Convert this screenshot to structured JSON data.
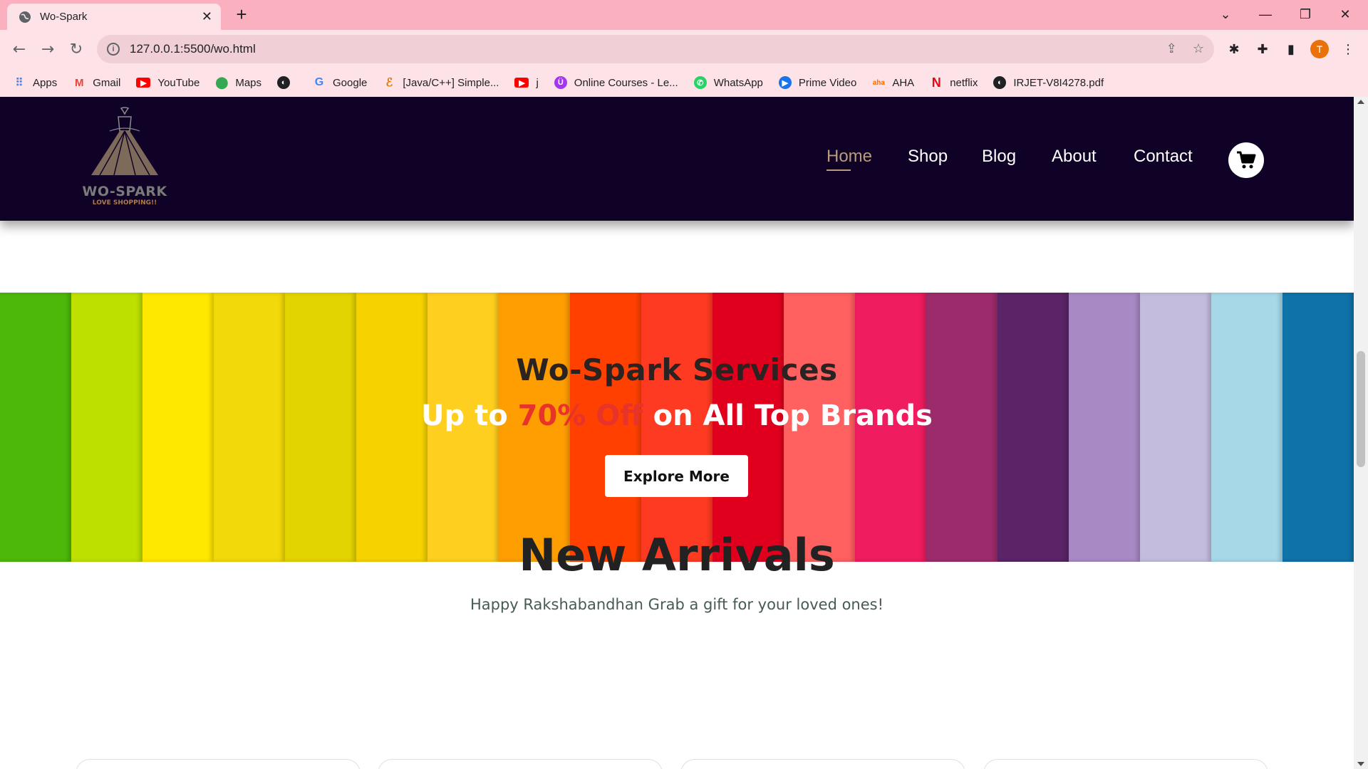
{
  "browser": {
    "tab_title": "Wo-Spark",
    "url": "127.0.0.1:5500/wo.html",
    "profile_initial": "T",
    "bookmarks": [
      {
        "label": "Apps",
        "icon": "apps-grid-icon"
      },
      {
        "label": "Gmail",
        "icon": "gmail-icon"
      },
      {
        "label": "YouTube",
        "icon": "youtube-icon"
      },
      {
        "label": "Maps",
        "icon": "maps-pin-icon"
      },
      {
        "label": "",
        "icon": "globe-icon"
      },
      {
        "label": "Google",
        "icon": "google-icon"
      },
      {
        "label": "[Java/C++] Simple...",
        "icon": "code-icon"
      },
      {
        "label": "j",
        "icon": "youtube-icon"
      },
      {
        "label": "Online Courses - Le...",
        "icon": "udemy-icon"
      },
      {
        "label": "WhatsApp",
        "icon": "whatsapp-icon"
      },
      {
        "label": "Prime Video",
        "icon": "prime-video-icon"
      },
      {
        "label": "AHA",
        "icon": "aha-icon"
      },
      {
        "label": "netflix",
        "icon": "netflix-icon"
      },
      {
        "label": "IRJET-V8I4278.pdf",
        "icon": "globe-icon"
      }
    ]
  },
  "site": {
    "logo": {
      "brand": "WO-SPARK",
      "tagline": "LOVE SHOPPING!!"
    },
    "nav": [
      {
        "label": "Home",
        "active": true
      },
      {
        "label": "Shop",
        "active": false
      },
      {
        "label": "Blog",
        "active": false
      },
      {
        "label": "About",
        "active": false
      },
      {
        "label": "Contact",
        "active": false
      }
    ],
    "cart_icon": "shopping-cart-icon",
    "colors": {
      "header_bg": "#0f0226",
      "active_nav": "#b89a7e",
      "highlight": "#e8332b"
    }
  },
  "banner": {
    "title": "Wo-Spark Services",
    "subtitle_pre": "Up to ",
    "subtitle_highlight": "70% Off",
    "subtitle_post": " on All Top Brands",
    "button_label": "Explore More",
    "stripe_colors": [
      "#4db80a",
      "#bde000",
      "#ffe800",
      "#f2d90a",
      "#e2d400",
      "#f6d200",
      "#ffcf1f",
      "#ff9e00",
      "#ff4000",
      "#ff3a22",
      "#e0001e",
      "#ff6060",
      "#ef1c5f",
      "#9c2b6b",
      "#5a2466",
      "#a889c4",
      "#c3bcdc",
      "#a6d8e8",
      "#0f72a8"
    ]
  },
  "new_arrivals": {
    "title": "New Arrivals",
    "subtitle": "Happy Rakshabandhan Grab a gift for your loved ones!"
  }
}
